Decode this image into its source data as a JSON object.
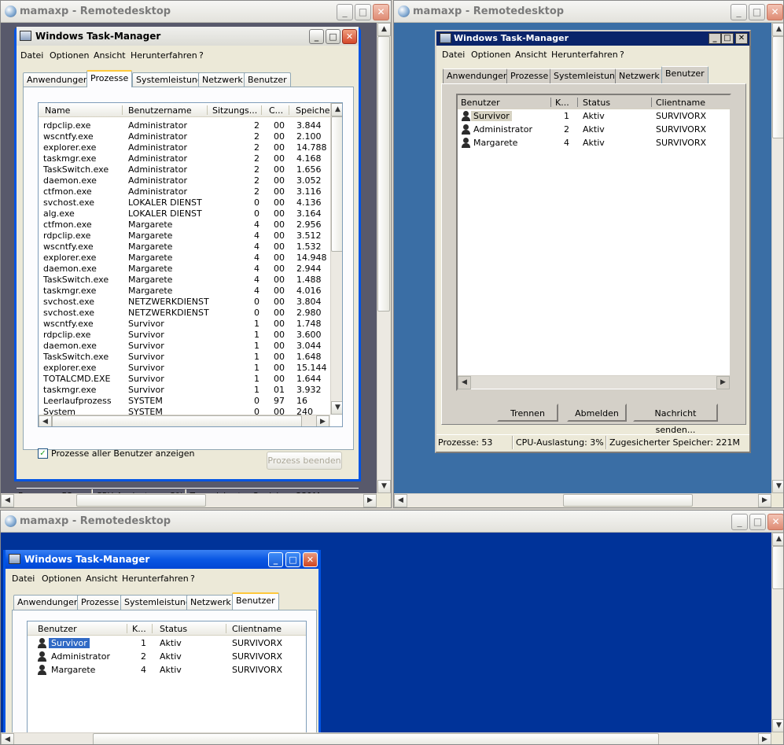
{
  "remote_title": "mamaxp - Remotedesktop",
  "tm_title": "Windows Task-Manager",
  "menu": [
    "Datei",
    "Optionen",
    "Ansicht",
    "Herunterfahren",
    "?"
  ],
  "tabs": [
    "Anwendungen",
    "Prozesse",
    "Systemleistung",
    "Netzwerk",
    "Benutzer"
  ],
  "process_columns": [
    "Name",
    "Benutzername",
    "Sitzungs...",
    "C...",
    "Speicher"
  ],
  "processes": [
    [
      "rdpclip.exe",
      "Administrator",
      "2",
      "00",
      "3.844"
    ],
    [
      "wscntfy.exe",
      "Administrator",
      "2",
      "00",
      "2.100"
    ],
    [
      "explorer.exe",
      "Administrator",
      "2",
      "00",
      "14.788"
    ],
    [
      "taskmgr.exe",
      "Administrator",
      "2",
      "00",
      "4.168"
    ],
    [
      "TaskSwitch.exe",
      "Administrator",
      "2",
      "00",
      "1.656"
    ],
    [
      "daemon.exe",
      "Administrator",
      "2",
      "00",
      "3.052"
    ],
    [
      "ctfmon.exe",
      "Administrator",
      "2",
      "00",
      "3.116"
    ],
    [
      "svchost.exe",
      "LOKALER DIENST",
      "0",
      "00",
      "4.136"
    ],
    [
      "alg.exe",
      "LOKALER DIENST",
      "0",
      "00",
      "3.164"
    ],
    [
      "ctfmon.exe",
      "Margarete",
      "4",
      "00",
      "2.956"
    ],
    [
      "rdpclip.exe",
      "Margarete",
      "4",
      "00",
      "3.512"
    ],
    [
      "wscntfy.exe",
      "Margarete",
      "4",
      "00",
      "1.532"
    ],
    [
      "explorer.exe",
      "Margarete",
      "4",
      "00",
      "14.948"
    ],
    [
      "daemon.exe",
      "Margarete",
      "4",
      "00",
      "2.944"
    ],
    [
      "TaskSwitch.exe",
      "Margarete",
      "4",
      "00",
      "1.488"
    ],
    [
      "taskmgr.exe",
      "Margarete",
      "4",
      "00",
      "4.016"
    ],
    [
      "svchost.exe",
      "NETZWERKDIENST",
      "0",
      "00",
      "3.804"
    ],
    [
      "svchost.exe",
      "NETZWERKDIENST",
      "0",
      "00",
      "2.980"
    ],
    [
      "wscntfy.exe",
      "Survivor",
      "1",
      "00",
      "1.748"
    ],
    [
      "rdpclip.exe",
      "Survivor",
      "1",
      "00",
      "3.600"
    ],
    [
      "daemon.exe",
      "Survivor",
      "1",
      "00",
      "3.044"
    ],
    [
      "TaskSwitch.exe",
      "Survivor",
      "1",
      "00",
      "1.648"
    ],
    [
      "explorer.exe",
      "Survivor",
      "1",
      "00",
      "15.144"
    ],
    [
      "TOTALCMD.EXE",
      "Survivor",
      "1",
      "00",
      "1.644"
    ],
    [
      "taskmgr.exe",
      "Survivor",
      "1",
      "01",
      "3.932"
    ],
    [
      "Leerlaufprozess",
      "SYSTEM",
      "0",
      "97",
      "16"
    ],
    [
      "System",
      "SYSTEM",
      "0",
      "00",
      "240"
    ]
  ],
  "show_all_label": "Prozesse aller Benutzer anzeigen",
  "end_process_label": "Prozess beenden",
  "user_columns": [
    "Benutzer",
    "K...",
    "Status",
    "Clientname"
  ],
  "users": [
    [
      "Survivor",
      "1",
      "Aktiv",
      "SURVIVORX"
    ],
    [
      "Administrator",
      "2",
      "Aktiv",
      "SURVIVORX"
    ],
    [
      "Margarete",
      "4",
      "Aktiv",
      "SURVIVORX"
    ]
  ],
  "buttons": {
    "disconnect": "Trennen",
    "logoff": "Abmelden",
    "send_message": "Nachricht senden..."
  },
  "status": {
    "processes": "Prozesse: 53",
    "cpu": "CPU-Auslastung: 3%",
    "memory": "Zugesicherter Speicher: 221M"
  },
  "colors": {
    "desktop_blue": "#3a6ea5",
    "desktop_dark": "#003399",
    "gray_bg": "#58596b"
  }
}
